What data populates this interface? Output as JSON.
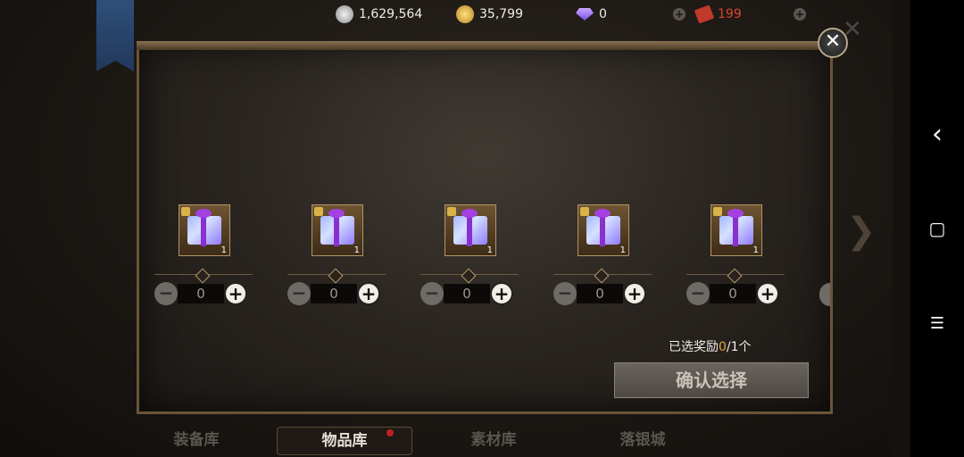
{
  "currency": {
    "silver": "1,629,564",
    "gold": "35,799",
    "gem": "0",
    "ticket": "199"
  },
  "rewards": [
    {
      "count": "1",
      "qty": "0"
    },
    {
      "count": "1",
      "qty": "0"
    },
    {
      "count": "1",
      "qty": "0"
    },
    {
      "count": "1",
      "qty": "0"
    },
    {
      "count": "1",
      "qty": "0"
    }
  ],
  "selection": {
    "prefix": "已选奖励",
    "current": "0",
    "suffix": "/1个"
  },
  "confirm_label": "确认选择",
  "tabs": [
    {
      "label": "装备库"
    },
    {
      "label": "物品库"
    },
    {
      "label": "素材库"
    },
    {
      "label": "落银城"
    }
  ],
  "icons": {
    "close": "✕",
    "arrow": "❯",
    "plus": "+",
    "minus": "−",
    "nav_back": "‹",
    "nav_home": "▢",
    "nav_menu": "☰"
  }
}
